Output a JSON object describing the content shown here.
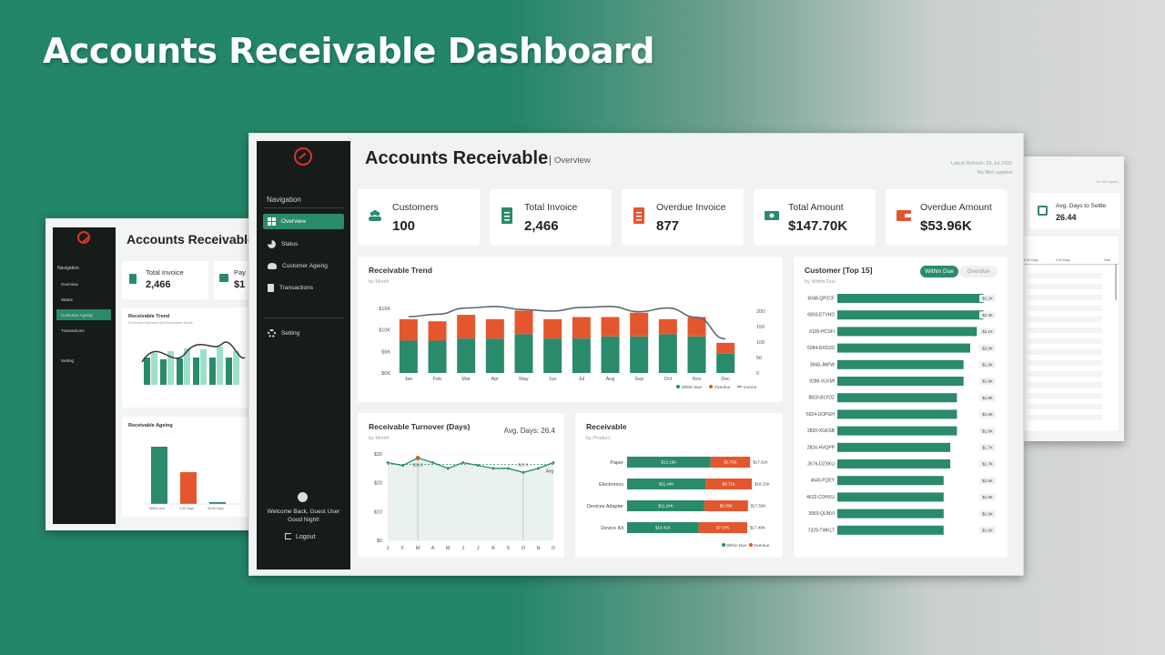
{
  "slide_title": "Accounts Receivable Dashboard",
  "colors": {
    "green": "#2a8a6c",
    "orange": "#e4572e",
    "dark": "#161c1a"
  },
  "main": {
    "header": {
      "title": "Accounts Receivable",
      "subtitle": "Overview",
      "refresh": "Latest Refresh: 26 Jul 2025",
      "filter": "No filter applied"
    },
    "sidebar": {
      "nav_title": "Navigation",
      "items": [
        "Overview",
        "Status",
        "Customer Ageing",
        "Transactions"
      ],
      "setting": "Setting",
      "welcome_1": "Welcome Back, Guest User",
      "welcome_2": "Good Night!",
      "logout": "Logout"
    },
    "kpis": [
      {
        "label": "Customers",
        "value": "100",
        "icon": "people-icon"
      },
      {
        "label": "Total Invoice",
        "value": "2,466",
        "icon": "invoice-icon"
      },
      {
        "label": "Overdue Invoice",
        "value": "877",
        "icon": "overdue-invoice-icon"
      },
      {
        "label": "Total Amount",
        "value": "$147.70K",
        "icon": "cash-icon"
      },
      {
        "label": "Overdue Amount",
        "value": "$53.96K",
        "icon": "wallet-icon"
      }
    ],
    "trend": {
      "title": "Receivable Trend",
      "sub": "by Month",
      "legend": [
        "Within Due",
        "Overdue",
        "Invoice"
      ]
    },
    "turnover": {
      "title": "Receivable Turnover (Days)",
      "sub": "by Month",
      "avg": "Avg. Days: 26.4",
      "avg_short": "Avg",
      "labels": [
        "$28.6",
        "$23.6"
      ]
    },
    "receivable": {
      "title": "Receivable",
      "sub": "by Product",
      "legend": [
        "Within Due",
        "Overdue"
      ]
    },
    "customers": {
      "title": "Customer [Top 15]",
      "sub": "by Within Due",
      "toggle_on": "Within Due",
      "toggle_off": "Overdue"
    }
  },
  "left_screen": {
    "title": "Accounts Receivable",
    "nav_title": "Navigation",
    "nav": [
      "Overview",
      "Status",
      "Customer Ageing",
      "Transactions"
    ],
    "setting": "Setting",
    "kpi_label": "Total Invoice",
    "kpi_value": "2,466",
    "kpi2_label": "Pay",
    "kpi2_value": "$1",
    "trend_title": "Receivable Trend",
    "trend_sub": "Purchases Payments and Receivables Month",
    "ageing_title": "Receivable Ageing",
    "ageing_labels": [
      "Within Due",
      "0-30 Days",
      "30-60 Days"
    ]
  },
  "right_screen": {
    "kpi_label": "Avg. Days to Settle",
    "kpi_value": "26.44",
    "filter": "No filter applied",
    "col1": "0-30 Days",
    "col2": "0-90 Days",
    "col3": "Total"
  },
  "chart_data": [
    {
      "type": "bar",
      "title": "Receivable Trend",
      "categories": [
        "Jan",
        "Feb",
        "Mar",
        "Apr",
        "May",
        "Jun",
        "Jul",
        "Aug",
        "Sep",
        "Oct",
        "Nov",
        "Dec"
      ],
      "series": [
        {
          "name": "Within Due",
          "values": [
            7.5,
            7.5,
            8.0,
            8.0,
            9.0,
            8.0,
            8.0,
            8.5,
            8.5,
            9.0,
            8.5,
            4.5
          ]
        },
        {
          "name": "Overdue",
          "values": [
            5.0,
            4.5,
            5.5,
            4.5,
            5.5,
            4.5,
            5.0,
            4.5,
            5.5,
            3.5,
            4.5,
            2.5
          ]
        },
        {
          "name": "Invoice",
          "values": [
            182,
            190,
            210,
            215,
            205,
            200,
            212,
            215,
            198,
            210,
            180,
            110
          ]
        }
      ],
      "left_ticks": [
        "$0K",
        "$5K",
        "$10K",
        "$15K"
      ],
      "right_ticks": [
        "0",
        "50",
        "100",
        "150",
        "200"
      ],
      "ylim": [
        0,
        15
      ],
      "y2lim": [
        0,
        200
      ],
      "legend": "bottom-right"
    },
    {
      "type": "line",
      "title": "Receivable Turnover (Days)",
      "categories": [
        "J",
        "F",
        "M",
        "A",
        "M",
        "J",
        "J",
        "A",
        "S",
        "O",
        "N",
        "D"
      ],
      "values": [
        27,
        26,
        28.6,
        27,
        25,
        27,
        26,
        25,
        25,
        23.6,
        25,
        27
      ],
      "average": 26.4,
      "y_ticks": [
        "$0",
        "$10",
        "$20",
        "$30"
      ],
      "ylim": [
        0,
        30
      ]
    },
    {
      "type": "bar",
      "title": "Receivable",
      "orientation": "horizontal",
      "categories": [
        "Paper",
        "Electronics",
        "Devices Adapter",
        "Device Kit"
      ],
      "series": [
        {
          "name": "Within Due",
          "values": [
            12.16,
            11.44,
            11.24,
            10.41
          ],
          "labels": [
            "$12.16K",
            "$11.44K",
            "$11.24K",
            "$10.41K"
          ]
        },
        {
          "name": "Overdue",
          "values": [
            5.75,
            6.71,
            6.35,
            7.07
          ],
          "labels": [
            "$5.75K",
            "$6.71K",
            "$6.35K",
            "$7.07K"
          ]
        }
      ],
      "totals": [
        "$17.91K",
        "$18.15K",
        "$17.59K",
        "$17.48K"
      ]
    },
    {
      "type": "bar",
      "title": "Customer [Top 15]",
      "orientation": "horizontal",
      "categories": [
        "6048-QP2CF",
        "6803-ETVHD",
        "6100-HCSFI",
        "5284-DXDZD",
        "3568-JMFW",
        "9286-VLKMI",
        "8820-BLYDZ",
        "5924-UOPGH",
        "2820-XGKSB",
        "2824-HVQPP",
        "2676-DZXKU",
        "4640-FQEY",
        "4632-COHXU",
        "3993-QUNVI",
        "7329-TWKLT"
      ],
      "values": [
        2.2,
        2.2,
        2.1,
        2.0,
        1.9,
        1.9,
        1.8,
        1.8,
        1.8,
        1.7,
        1.7,
        1.6,
        1.6,
        1.6,
        1.6
      ],
      "labels": [
        "$2.2K",
        "$2.2K",
        "$2.1K",
        "$2.0K",
        "$1.9K",
        "$1.9K",
        "$1.8K",
        "$1.8K",
        "$1.8K",
        "$1.7K",
        "$1.7K",
        "$1.6K",
        "$1.6K",
        "$1.6K",
        "$1.6K"
      ]
    }
  ]
}
